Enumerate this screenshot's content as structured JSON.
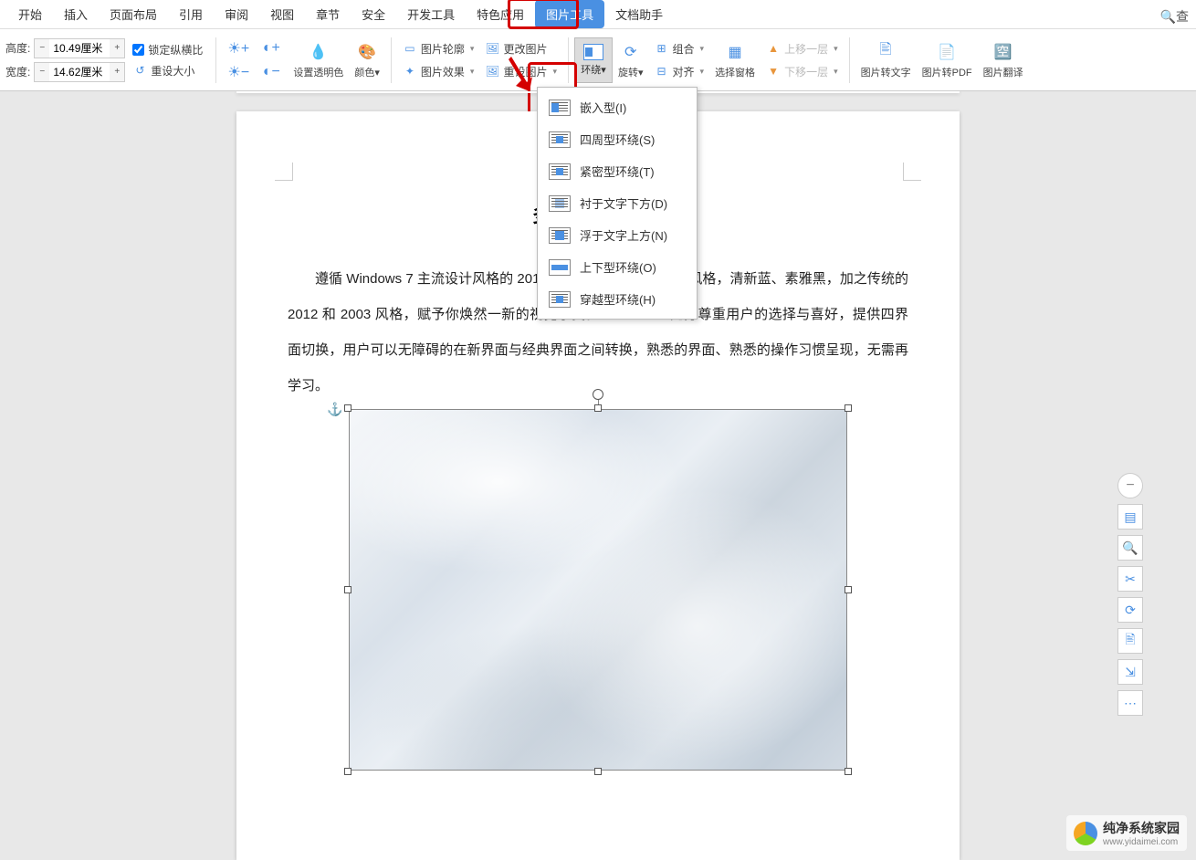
{
  "menu": {
    "items": [
      "开始",
      "插入",
      "页面布局",
      "引用",
      "审阅",
      "视图",
      "章节",
      "安全",
      "开发工具",
      "特色应用",
      "图片工具",
      "文档助手"
    ],
    "active_index": 10,
    "search_placeholder": "查"
  },
  "ribbon": {
    "height_label": "高度:",
    "width_label": "宽度:",
    "height_value": "10.49厘米",
    "width_value": "14.62厘米",
    "lock_ratio": "锁定纵横比",
    "reset_size": "重设大小",
    "set_transparency": "设置透明色",
    "color": "颜色",
    "pic_outline": "图片轮廓",
    "pic_effect": "图片效果",
    "change_pic": "更改图片",
    "reset_pic": "重设图片",
    "wrap": "环绕",
    "rotate": "旋转",
    "group": "组合",
    "align": "对齐",
    "select_pane": "选择窗格",
    "move_up": "上移一层",
    "move_down": "下移一层",
    "pic_to_text": "图片转文字",
    "pic_to_pdf": "图片转PDF",
    "pic_translate": "图片翻译"
  },
  "dropdown": {
    "items": [
      {
        "label": "嵌入型(I)"
      },
      {
        "label": "四周型环绕(S)"
      },
      {
        "label": "紧密型环绕(T)"
      },
      {
        "label": "衬于文字下方(D)"
      },
      {
        "label": "浮于文字上方(N)"
      },
      {
        "label": "上下型环绕(O)"
      },
      {
        "label": "穿越型环绕(H)"
      }
    ]
  },
  "document": {
    "title": "多种界面切换",
    "paragraph": "遵循 Windows 7 主流设计风格的 2013 界面，并且有两种色彩风格，清新蓝、素雅黑，加之传统的 2012 和 2003 风格，赋予你焕然一新的视觉享受。WPS 2013 充分尊重用户的选择与喜好，提供四界面切换，用户可以无障碍的在新界面与经典界面之间转换，熟悉的界面、熟悉的操作习惯呈现，无需再学习。"
  },
  "watermark": {
    "text": "纯净系统家园",
    "url": "www.yidaimei.com"
  }
}
